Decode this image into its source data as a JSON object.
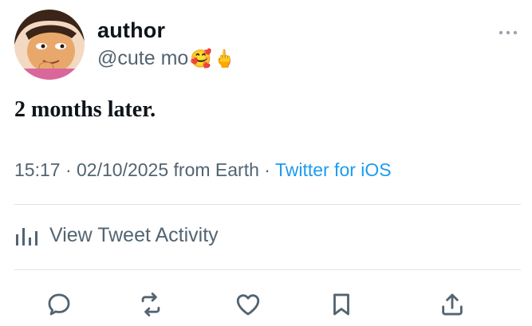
{
  "tweet": {
    "author_name": "author",
    "handle_text": "@cute mo",
    "handle_emojis": [
      "🥰",
      "🖕"
    ],
    "body": "2 months later.",
    "time": "15:17",
    "date": "02/10/2025",
    "from": "from Earth",
    "client": "Twitter for iOS",
    "activity_label": "View Tweet Activity"
  },
  "icons": {
    "more": "more-icon",
    "analytics": "bar-chart-icon",
    "reply": "reply-icon",
    "retweet": "retweet-icon",
    "like": "heart-icon",
    "bookmark": "bookmark-icon",
    "share": "share-icon"
  },
  "colors": {
    "link": "#1d9bf0",
    "secondary_text": "#536471",
    "primary_text": "#0f1419",
    "divider": "#dfe3e6"
  }
}
